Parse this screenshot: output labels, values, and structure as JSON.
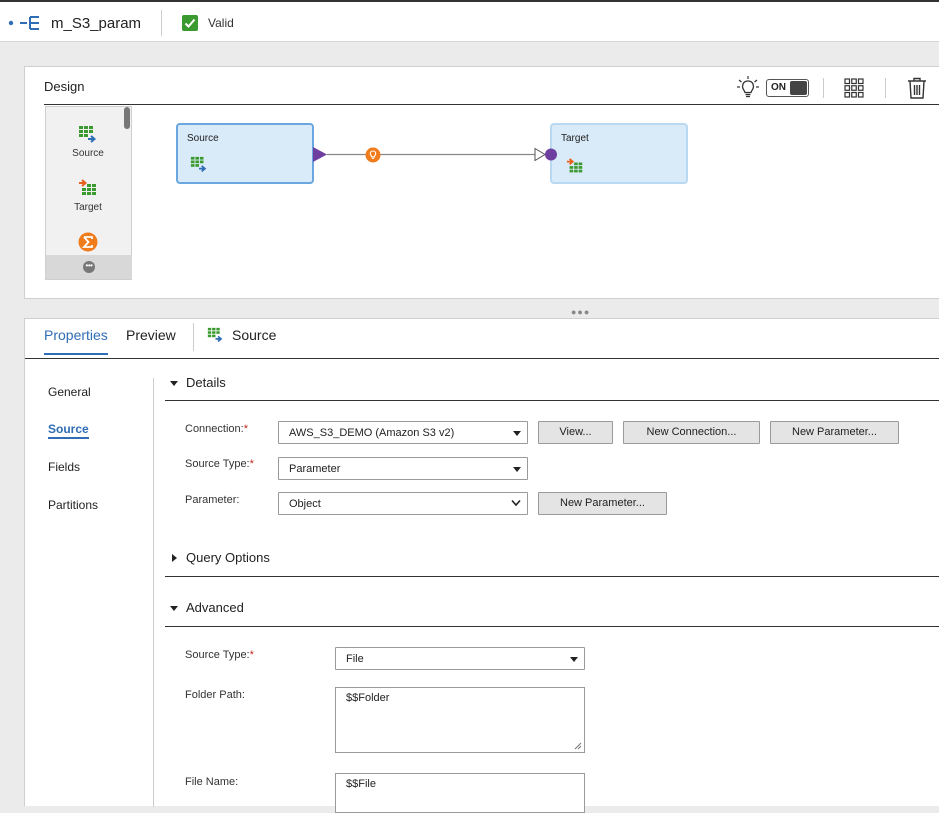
{
  "header": {
    "mapping_name": "m_S3_param",
    "status": "Valid"
  },
  "design": {
    "title": "Design",
    "toggle_label": "ON",
    "palette": [
      {
        "label": "Source"
      },
      {
        "label": "Target"
      }
    ],
    "nodes": {
      "source": "Source",
      "target": "Target"
    }
  },
  "tabs": {
    "properties": "Properties",
    "preview": "Preview",
    "selected_object": "Source"
  },
  "nav": {
    "general": "General",
    "source": "Source",
    "fields": "Fields",
    "partitions": "Partitions"
  },
  "details": {
    "title": "Details",
    "connection_label": "Connection:",
    "connection_value": "AWS_S3_DEMO (Amazon S3 v2)",
    "view_button": "View...",
    "new_connection_button": "New Connection...",
    "new_parameter_button": "New Parameter...",
    "source_type_label": "Source Type:",
    "source_type_value": "Parameter",
    "parameter_label": "Parameter:",
    "parameter_value": "Object",
    "parameter_new_button": "New Parameter..."
  },
  "query_options": {
    "title": "Query Options"
  },
  "advanced": {
    "title": "Advanced",
    "source_type_label": "Source Type:",
    "source_type_value": "File",
    "folder_path_label": "Folder Path:",
    "folder_path_value": "$$Folder",
    "file_name_label": "File Name:",
    "file_name_value": "$$File"
  },
  "required_marker": "*"
}
